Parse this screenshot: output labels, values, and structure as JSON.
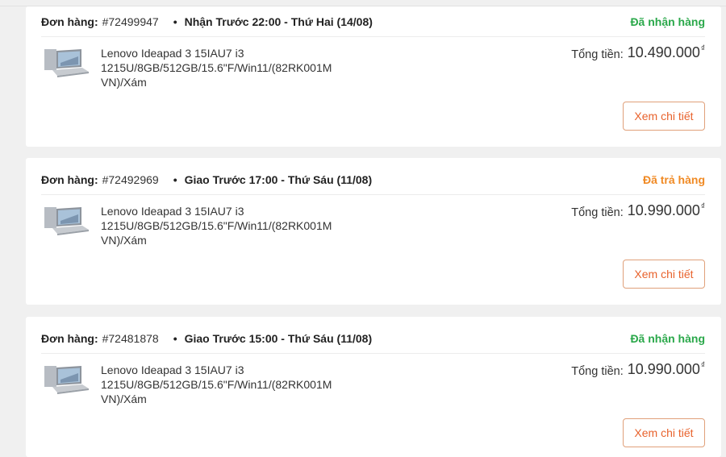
{
  "orders": [
    {
      "order_label": "Đơn hàng:",
      "order_code": "#72499947",
      "bullet": "•",
      "delivery": "Nhận Trước 22:00 - Thứ Hai (14/08)",
      "status": "Đã nhận hàng",
      "status_color": "#2aa84a",
      "product_image_icon": "laptop-thumbnail",
      "product_name": "Lenovo Ideapad 3 15IAU7 i3 1215U/8GB/512GB/15.6\"F/Win11/(82RK001M VN)/Xám",
      "total_label": "Tổng tiền:",
      "total_amount": "10.490.000",
      "currency_symbol": "₫",
      "detail_button": "Xem chi tiết"
    },
    {
      "order_label": "Đơn hàng:",
      "order_code": "#72492969",
      "bullet": "•",
      "delivery": "Giao Trước 17:00 - Thứ Sáu (11/08)",
      "status": "Đã trả hàng",
      "status_color": "#f08a24",
      "product_image_icon": "laptop-thumbnail",
      "product_name": "Lenovo Ideapad 3 15IAU7 i3 1215U/8GB/512GB/15.6\"F/Win11/(82RK001M VN)/Xám",
      "total_label": "Tổng tiền:",
      "total_amount": "10.990.000",
      "currency_symbol": "₫",
      "detail_button": "Xem chi tiết"
    },
    {
      "order_label": "Đơn hàng:",
      "order_code": "#72481878",
      "bullet": "•",
      "delivery": "Giao Trước 15:00 - Thứ Sáu (11/08)",
      "status": "Đã nhận hàng",
      "status_color": "#2aa84a",
      "product_image_icon": "laptop-thumbnail",
      "product_name": "Lenovo Ideapad 3 15IAU7 i3 1215U/8GB/512GB/15.6\"F/Win11/(82RK001M VN)/Xám",
      "total_label": "Tổng tiền:",
      "total_amount": "10.990.000",
      "currency_symbol": "₫",
      "detail_button": "Xem chi tiết"
    }
  ],
  "colors": {
    "page_background": "#f0f0f0",
    "card_background": "#ffffff",
    "button_text": "#e8622c",
    "button_border": "#e0a07a"
  }
}
